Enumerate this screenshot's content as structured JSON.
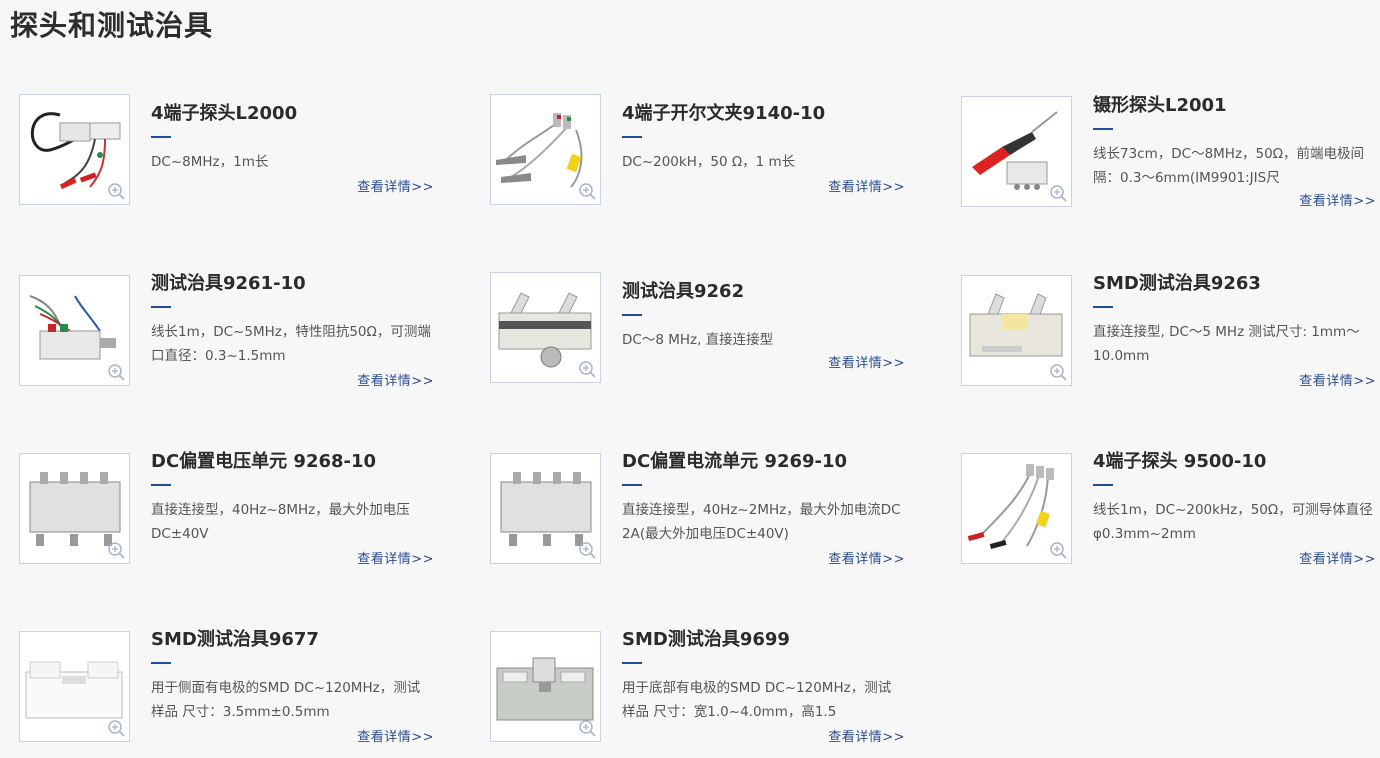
{
  "page": {
    "title": "探头和测试治具"
  },
  "colors": {
    "accent": "#1f4f9c",
    "link": "#2a4d8f",
    "thumb_border": "#c9d3e3"
  },
  "products": [
    {
      "name": "4端子探头L2000",
      "desc": "DC~8MHz，1m长",
      "more": "查看详情>>",
      "image_icon": "cable-probe-image"
    },
    {
      "name": "4端子开尔文夹9140-10",
      "desc": "DC~200kH，50 Ω，1 m长",
      "more": "查看详情>>",
      "image_icon": "kelvin-clip-image"
    },
    {
      "name": "镊形探头L2001",
      "desc": "线长73cm，DC～8MHz，50Ω，前端电极间隔：0.3～6mm(IM9901:JIS尺",
      "more": "查看详情>>",
      "image_icon": "tweezer-probe-image"
    },
    {
      "name": "测试治具9261-10",
      "desc": "线长1m，DC~5MHz，特性阻抗50Ω，可测端口直径：0.3~1.5mm",
      "more": "查看详情>>",
      "image_icon": "fixture-cable-image"
    },
    {
      "name": "测试治具9262",
      "desc": "DC～8 MHz, 直接连接型",
      "more": "查看详情>>",
      "image_icon": "fixture-knob-image"
    },
    {
      "name": "SMD测试治具9263",
      "desc": "直接连接型, DC～5 MHz 测试尺寸: 1mm～10.0mm",
      "more": "查看详情>>",
      "image_icon": "smd-fixture-image"
    },
    {
      "name": "DC偏置电压单元 9268-10",
      "desc": "直接连接型，40Hz~8MHz，最大外加电压DC±40V",
      "more": "查看详情>>",
      "image_icon": "bias-voltage-unit-image"
    },
    {
      "name": "DC偏置电流单元 9269-10",
      "desc": "直接连接型，40Hz~2MHz，最大外加电流DC 2A(最大外加电压DC±40V)",
      "more": "查看详情>>",
      "image_icon": "bias-current-unit-image"
    },
    {
      "name": "4端子探头 9500-10",
      "desc": "线长1m，DC~200kHz，50Ω，可测导体直径φ0.3mm~2mm",
      "more": "查看详情>>",
      "image_icon": "four-terminal-probe-image"
    },
    {
      "name": "SMD测试治具9677",
      "desc": "用于侧面有电极的SMD DC~120MHz，测试样品 尺寸：3.5mm±0.5mm",
      "more": "查看详情>>",
      "image_icon": "smd-side-fixture-image"
    },
    {
      "name": "SMD测试治具9699",
      "desc": "用于底部有电极的SMD DC~120MHz，测试样品 尺寸：宽1.0~4.0mm，高1.5",
      "more": "查看详情>>",
      "image_icon": "smd-bottom-fixture-image"
    }
  ]
}
